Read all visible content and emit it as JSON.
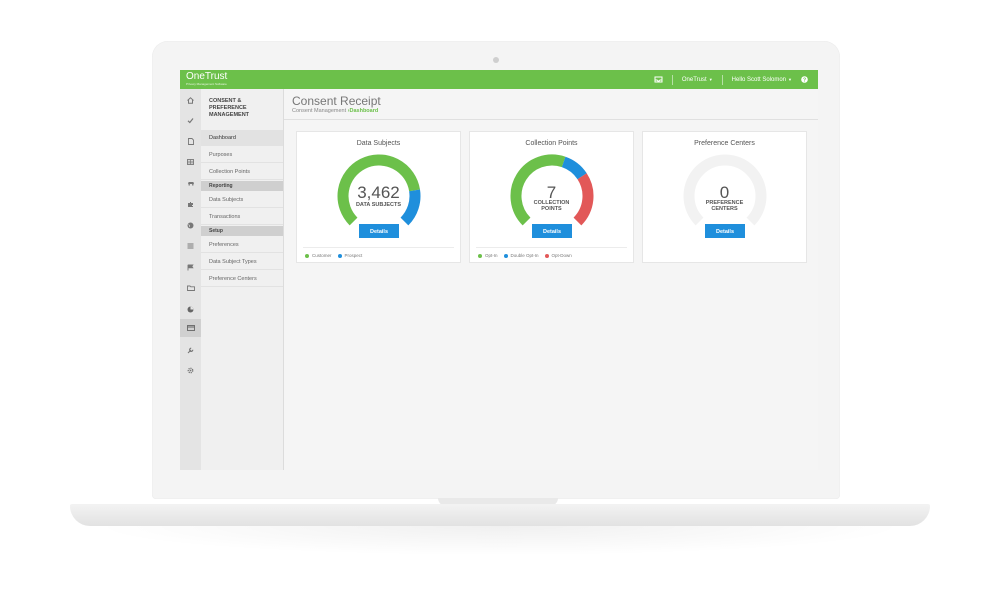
{
  "colors": {
    "brand_green": "#6cc04a",
    "accent_blue": "#1f8fdc",
    "opt_down_red": "#e25858",
    "empty_ring": "#f2f2f2"
  },
  "topbar": {
    "brand": "OneTrust",
    "brand_sub": "Privacy Management Software",
    "org_menu": "OneTrust",
    "user_menu": "Hello Scott Solomon",
    "icons": [
      "inbox-icon",
      "help-icon"
    ]
  },
  "rail": {
    "icons": [
      "home-icon",
      "check-icon",
      "document-icon",
      "grid-icon",
      "car-icon",
      "puzzle-icon",
      "globe-icon",
      "list-icon",
      "flag-icon",
      "folder-icon",
      "pie-icon",
      "card-icon",
      "wrench-icon",
      "gear-icon"
    ],
    "active_index": 11
  },
  "subnav": {
    "title": "CONSENT & PREFERENCE MANAGEMENT",
    "items": {
      "dashboard": "Dashboard",
      "purposes": "Purposes",
      "collection_points": "Collection Points",
      "reporting": "Reporting",
      "data_subjects": "Data Subjects",
      "transactions": "Transactions",
      "setup": "Setup",
      "preferences": "Preferences",
      "data_subject_types": "Data Subject Types",
      "preference_centers": "Preference Centers"
    }
  },
  "main": {
    "title": "Consent Receipt",
    "breadcrumb_parent": "Consent Management",
    "breadcrumb_sep": "›",
    "breadcrumb_current": "Dashboard"
  },
  "cards": [
    {
      "title": "Data Subjects",
      "value": "3,462",
      "label": "DATA SUBJECTS",
      "button": "Details",
      "segments": [
        {
          "name": "Customer",
          "fraction": 0.8,
          "color": "#6cc04a"
        },
        {
          "name": "Prospect",
          "fraction": 0.2,
          "color": "#1f8fdc"
        }
      ],
      "legend": [
        "Customer",
        "Prospect"
      ]
    },
    {
      "title": "Collection Points",
      "value": "7",
      "label_line1": "COLLECTION",
      "label_line2": "POINTS",
      "button": "Details",
      "segments": [
        {
          "name": "Opt-In",
          "fraction": 0.57,
          "color": "#6cc04a"
        },
        {
          "name": "Double Opt-In",
          "fraction": 0.14,
          "color": "#1f8fdc"
        },
        {
          "name": "Opt-Down",
          "fraction": 0.29,
          "color": "#e25858"
        }
      ],
      "legend": [
        "Opt-In",
        "Double Opt-In",
        "Opt-Down"
      ]
    },
    {
      "title": "Preference Centers",
      "value": "0",
      "label_line1": "PREFERENCE",
      "label_line2": "CENTERS",
      "button": "Details",
      "segments": [],
      "legend": []
    }
  ]
}
